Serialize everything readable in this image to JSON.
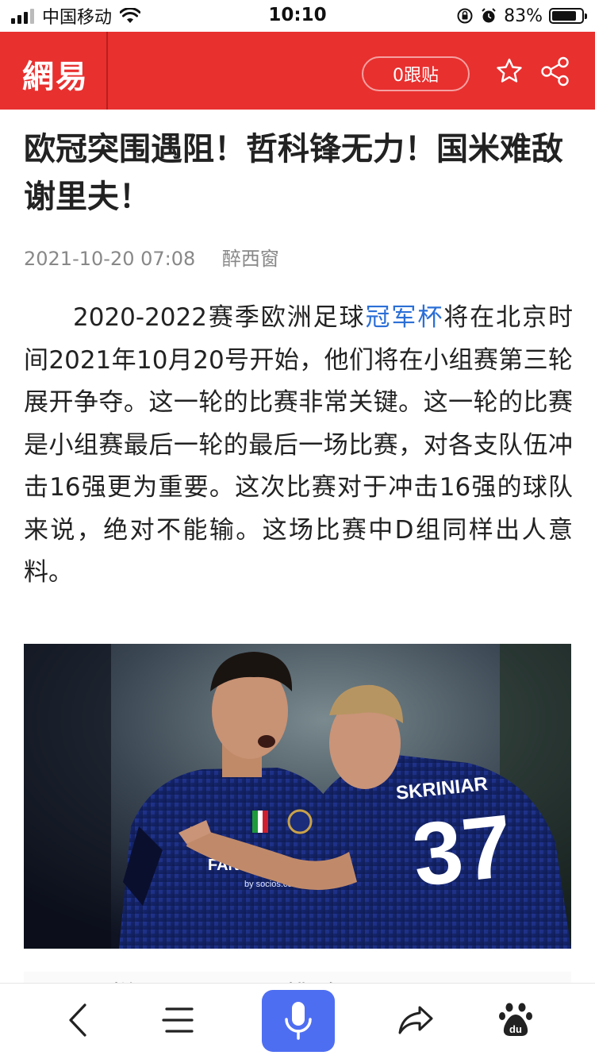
{
  "status_bar": {
    "carrier": "中国移动",
    "time": "10:10",
    "battery_percent": "83%",
    "battery_level": 0.83
  },
  "header": {
    "logo": "網易",
    "follow_label": "0跟贴",
    "brand_color": "#e8302f"
  },
  "article": {
    "title": "欧冠突围遇阻！哲科锋无力！国米难敌谢里夫！",
    "date": "2021-10-20 07:08",
    "source": "醉西窗",
    "body_before_link": "2020-2022赛季欧洲足球",
    "link_text": "冠军杯",
    "body_after_link": "将在北京时间2021年10月20号开始，他们将在小组赛第三轮展开争夺。这一轮的比赛非常关键。这一轮的比赛是小组赛最后一轮的最后一场比赛，对各支队伍冲击16强更为重要。这次比赛对于冲击16强的球队来说，绝对不能输。这场比赛中D组同样出人意料。",
    "link_color": "#2b6fd6",
    "next_paragraph_fragment": "下样图及……排名"
  },
  "photo": {
    "shirt_sponsor": "FAN",
    "sleeve_text": "by socios.com",
    "player_name": "SKRINIAR",
    "player_number": "37"
  },
  "bottom_bar": {
    "icons": [
      "back-icon",
      "menu-icon",
      "mic-icon",
      "share-icon",
      "baidu-paw-icon"
    ],
    "baidu_label": "du",
    "accent_color": "#4e6ef2"
  }
}
